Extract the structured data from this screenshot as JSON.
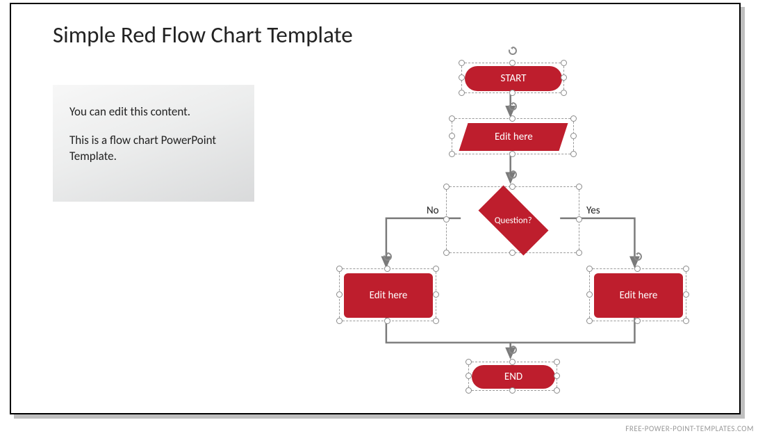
{
  "title": "Simple Red Flow Chart Template",
  "textbox": {
    "line1": "You can edit this content.",
    "line2": "This is a flow chart PowerPoint Template."
  },
  "flow": {
    "start": "START",
    "input": "Edit here",
    "decision": "Question?",
    "branch_no": "No",
    "branch_yes": "Yes",
    "left_process": "Edit here",
    "right_process": "Edit here",
    "end": "END"
  },
  "footer": "FREE-POWER-POINT-TEMPLATES.COM",
  "colors": {
    "shape_fill": "#be1e2d"
  }
}
